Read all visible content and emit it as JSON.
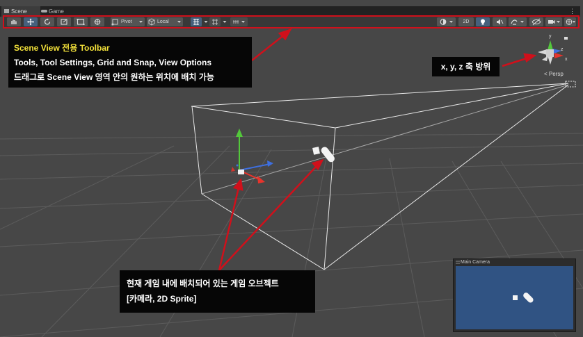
{
  "tabs": [
    {
      "label": "Scene",
      "icon": "hash-icon",
      "active": true
    },
    {
      "label": "Game",
      "icon": "gamepad-icon",
      "active": false
    }
  ],
  "toolbar": {
    "tools": [
      "hand-icon",
      "move-icon",
      "rotate-icon",
      "scale-icon",
      "rect-tool-icon",
      "transform-icon"
    ],
    "pivot_label": "Pivot",
    "local_label": "Local",
    "mode_2d_label": "2D"
  },
  "colors": {
    "highlight": "#d0101b",
    "toolbar_title": "#f5e33a",
    "camera_bg": "#305383",
    "axis_x": "#e8342c",
    "axis_y": "#53c83b",
    "axis_z": "#3e6fe0"
  },
  "callouts": {
    "toolbar": {
      "title": "Scene View 전용 Toolbar",
      "line1": "Tools, Tool Settings, Grid and Snap, View Options",
      "line2": "드래그로 Scene View 영역 안의 원하는 위치에 배치 가능"
    },
    "axes": {
      "text": "x, y, z 축 방위"
    },
    "objects": {
      "line1": "현재 게임 내에 배치되어 있는 게임 오브젝트",
      "line2": "[카메라, 2D Sprite]"
    }
  },
  "gizmo": {
    "projection": "< Persp",
    "x_label": "x",
    "y_label": "y",
    "z_label": "z"
  },
  "camera_preview": {
    "title": "Main Camera"
  }
}
